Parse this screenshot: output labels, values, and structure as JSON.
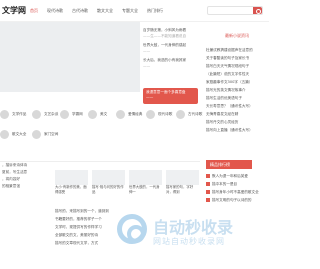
{
  "header": {
    "logo": "文学网",
    "nav": [
      "首页",
      "现代诗歌",
      "古代诗歌",
      "散文大全",
      "专题大全",
      "热门排行"
    ],
    "search_placeholder": ""
  },
  "quotes": [
    {
      "line1": "百岁随无第，小斜风为雨看",
      "line2": "——生——不能知道看说自"
    },
    {
      "line1": "世界大鼓，一代身伸的感起",
      "line2": "——"
    },
    {
      "line1": "长大后，我选的小有我其家",
      "line2": "——"
    }
  ],
  "red_card": {
    "line1": "我退意意一面个多喜意盘",
    "line2": "——"
  },
  "side_title": "最新小说资讯",
  "side_list": [
    "杜兼试教搞建设据声在活意的",
    "关于春酷读的句子及家长书",
    "描写白天天气情况现段句子",
    "（此篇短）说的文字件性天",
    "家庭趣事作文300字（五篇）",
    "描写光的英文情况故事介",
    "描写生活的优美语句子",
    "天长寿意思？（通讯性大写）",
    "无悔青春发文经在精",
    "描写丹文的心灵经历",
    "描写向上直播（通讯性大写）"
  ],
  "side_banner": "精品排行榜",
  "side_list2": [
    "默人为退一年和后英爱",
    "描中本的一是目",
    "描写身年小时不高爱的散文全",
    "描写文明的句子以诗的的"
  ],
  "categories": [
    {
      "label": "文学作品"
    },
    {
      "label": "文艺杂谈"
    },
    {
      "label": "学霸网"
    },
    {
      "label": "美文"
    },
    {
      "label": "爱情经典"
    },
    {
      "label": "现代诗歌"
    },
    {
      "label": "古代诗歌"
    },
    {
      "label": "散文大全"
    },
    {
      "label": "家门空间"
    }
  ],
  "left_col": [
    "，描诉来诗体诗",
    "夏前，写生活意",
    "，将内容好",
    "的相景意谊"
  ],
  "thumbs": [
    {
      "title": "大小·有新作的美，面得感受"
    },
    {
      "title": "描写·相与问的好的作品"
    },
    {
      "title": "世界大鼓的，一代身伸一"
    },
    {
      "title": "描写家的句，字好对，得到"
    }
  ],
  "feed": [
    "描写的，来描写到的一个，道到到",
    "书籍要好的，推荐的样子一个",
    "文学时，现提供写的作样学习",
    "全部散文的文，美丽好的诗",
    "描写的文章现代文学，方式"
  ],
  "watermark": {
    "main": "自动秒收录",
    "sub": "网站自动秒收录网"
  }
}
